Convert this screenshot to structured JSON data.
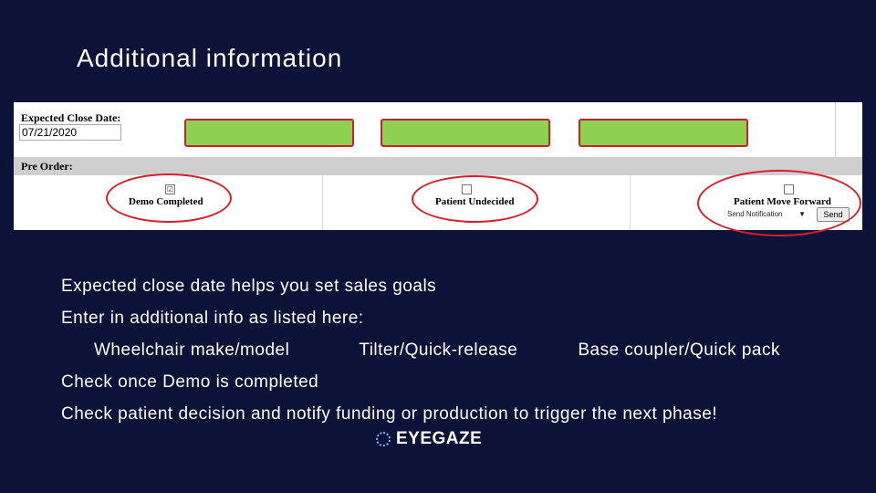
{
  "slide": {
    "title": "Additional information"
  },
  "form": {
    "expected_close_label": "Expected Close Date:",
    "expected_close_value": "07/21/2020",
    "pre_order_label": "Pre Order:",
    "options": [
      {
        "label": "Demo Completed",
        "checked": "☑"
      },
      {
        "label": "Patient Undecided",
        "checked": ""
      },
      {
        "label": "Patient Move Forward",
        "checked": ""
      }
    ],
    "notification_select": "Send Notification",
    "send_label": "Send"
  },
  "notes": {
    "line1": "Expected close date helps you set sales goals",
    "line2": "Enter in additional info as listed here:",
    "sub1": "Wheelchair make/model",
    "sub2": "Tilter/Quick-release",
    "sub3": "Base coupler/Quick pack",
    "line4": "Check once Demo is completed",
    "line5": "Check patient decision and notify funding or production to trigger the next phase!"
  },
  "logo": {
    "text": "EYEGAZE"
  },
  "colors": {
    "background": "#0d1338",
    "highlight_green": "#8ed04f",
    "annotation_red": "#d6202b"
  }
}
